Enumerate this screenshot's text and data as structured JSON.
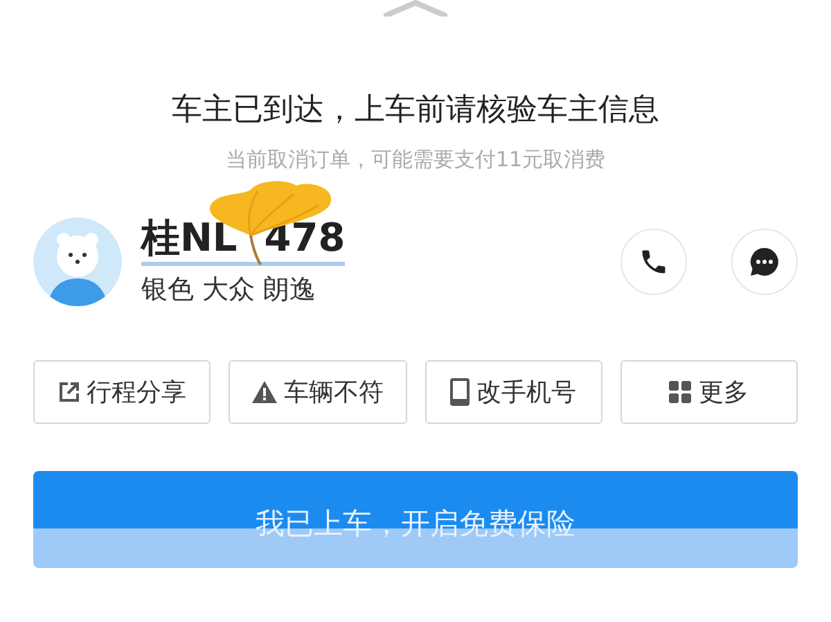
{
  "header": {
    "title": "车主已到达，上车前请核验车主信息",
    "subtitle": "当前取消订单，可能需要支付11元取消费"
  },
  "driver": {
    "plate_start": "桂NL",
    "plate_end": "478",
    "car": "银色 大众 朗逸"
  },
  "actions": [
    {
      "kind": "share",
      "label": "行程分享"
    },
    {
      "kind": "warning",
      "label": "车辆不符"
    },
    {
      "kind": "phone",
      "label": "改手机号"
    },
    {
      "kind": "more",
      "label": "更多"
    }
  ],
  "confirm_button": {
    "label": "我已上车，开启免费保险"
  }
}
